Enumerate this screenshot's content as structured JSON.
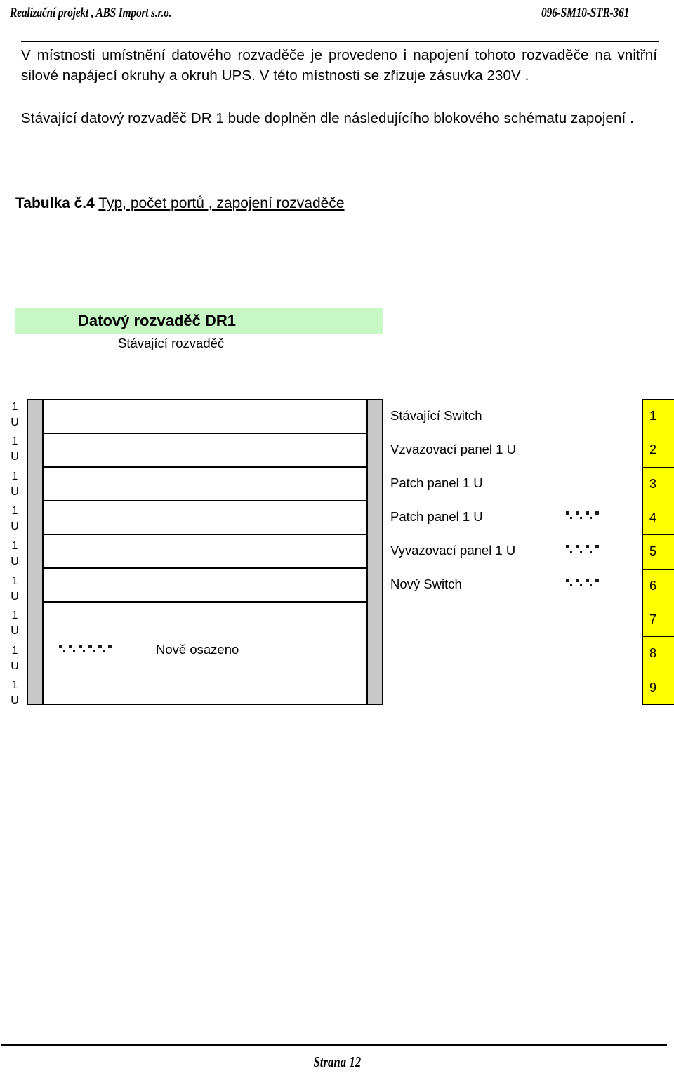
{
  "header": {
    "left_text": "Realizační projekt , ABS Import s.r.o.",
    "right_text": "096-SM10-STR-361"
  },
  "body": {
    "paragraph_1": "V místnosti umístnění datového rozvaděče je provedeno i napojení tohoto rozvaděče na vnitřní silové napájecí okruhy a okruh UPS. V této místnosti  se zřizuje zásuvka 230V .",
    "paragraph_2": "Stávající datový rozvaděč DR 1 bude doplněn dle následujícího blokového schématu zapojení ."
  },
  "caption": {
    "strong": "Tabulka č.4",
    "underlined": "Typ, počet portů , zapojení rozvaděče"
  },
  "figure": {
    "banner_title": "Datový rozvaděč DR1",
    "subtitle": "Stávající rozvaděč",
    "banner_color": "#c6f7c4",
    "rail_color": "#c8c8c8",
    "index_color": "#ffff00",
    "u_ruler": [
      {
        "count": "1",
        "unit": "U"
      },
      {
        "count": "1",
        "unit": "U"
      },
      {
        "count": "1",
        "unit": "U"
      },
      {
        "count": "1",
        "unit": "U"
      },
      {
        "count": "1",
        "unit": "U"
      },
      {
        "count": "1",
        "unit": "U"
      },
      {
        "count": "1",
        "unit": "U"
      },
      {
        "count": "1",
        "unit": "U"
      },
      {
        "count": "1",
        "unit": "U"
      }
    ],
    "legend": {
      "label": "Nově osazeno"
    },
    "devices": [
      {
        "name": "Stávající Switch",
        "marked": false
      },
      {
        "name": "Vzvazovací panel 1 U",
        "marked": false
      },
      {
        "name": "Patch panel 1 U",
        "marked": false
      },
      {
        "name": "Patch panel 1 U",
        "marked": true
      },
      {
        "name": "Vyvazovací panel 1 U",
        "marked": true
      },
      {
        "name": "Nový Switch",
        "marked": true
      },
      {
        "name": "",
        "marked": false
      },
      {
        "name": "",
        "marked": false
      },
      {
        "name": "",
        "marked": false
      }
    ],
    "index_numbers": [
      "1",
      "2",
      "3",
      "4",
      "5",
      "6",
      "7",
      "8",
      "9"
    ]
  },
  "footer": {
    "page_label": "Strana 12"
  }
}
